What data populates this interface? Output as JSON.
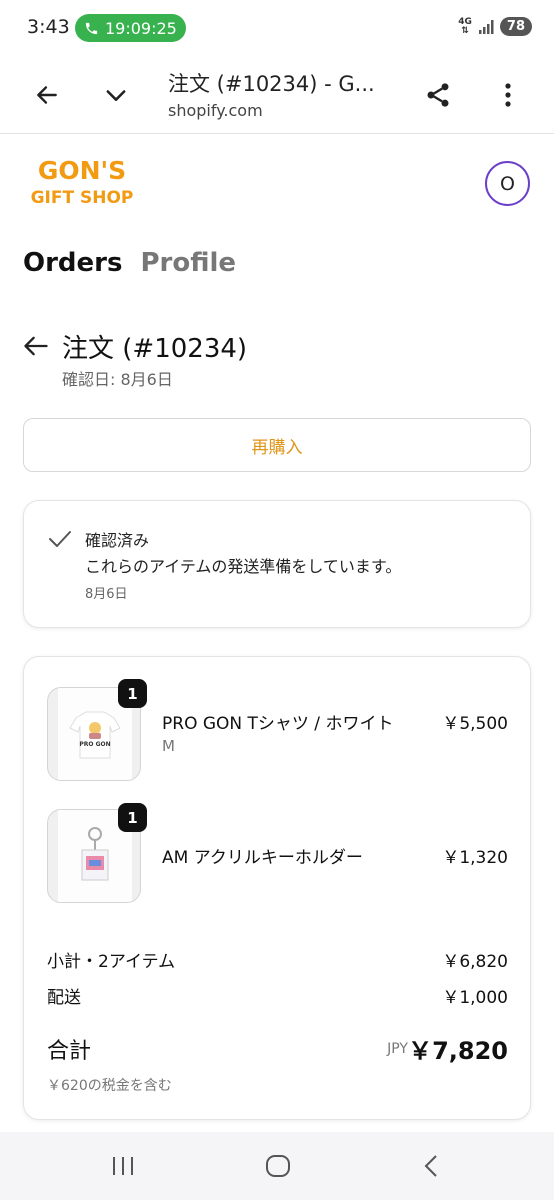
{
  "status_bar": {
    "time": "3:43",
    "call_timer": "19:09:25",
    "network": "4G",
    "battery": "78"
  },
  "browser": {
    "tab_title": "注文 (#10234) - G...",
    "url": "shopify.com"
  },
  "shop": {
    "logo_line1": "GON'S",
    "logo_line2": "GIFT SHOP",
    "avatar_initial": "O"
  },
  "nav": {
    "orders": "Orders",
    "profile": "Profile"
  },
  "order": {
    "title": "注文 (#10234)",
    "confirmed_date": "確認日: 8月6日",
    "rebuy_label": "再購入"
  },
  "status": {
    "title": "確認済み",
    "message": "これらのアイテムの発送準備をしています。",
    "date": "8月6日"
  },
  "items": [
    {
      "name": "PRO GON Tシャツ / ホワイト",
      "variant": "M",
      "price": "￥5,500",
      "qty": "1",
      "image_text": "PRO GON"
    },
    {
      "name": "AM アクリルキーホルダー",
      "variant": "",
      "price": "￥1,320",
      "qty": "1"
    }
  ],
  "summary": {
    "subtotal_label": "小計・2アイテム",
    "subtotal": "￥6,820",
    "shipping_label": "配送",
    "shipping": "￥1,000",
    "total_label": "合計",
    "currency": "JPY",
    "total": "￥7,820",
    "tax_note": "￥620の税金を含む"
  },
  "colors": {
    "accent": "#e0961a",
    "logo": "#f29a12",
    "avatar_ring": "#6b3fc8",
    "call_green": "#38b24f"
  }
}
